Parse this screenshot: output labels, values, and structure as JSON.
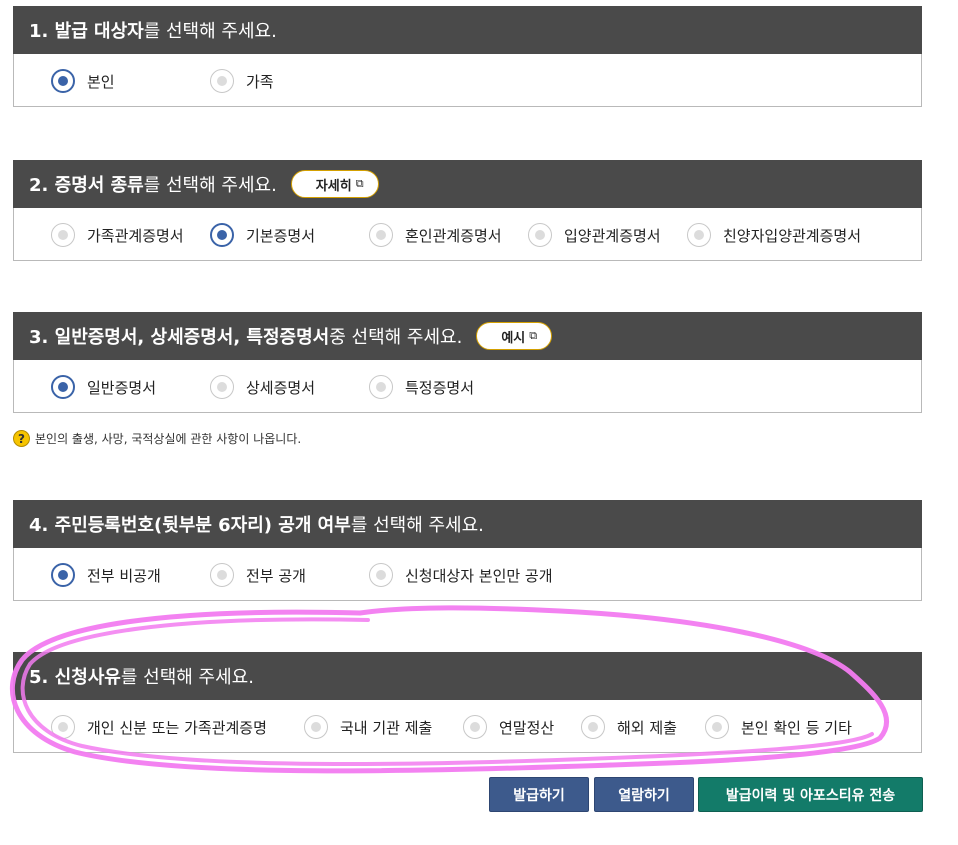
{
  "sections": [
    {
      "bold": "1. 발급 대상자",
      "rest": "를 선택해 주세요.",
      "suffix_bold": "",
      "suffix_rest": "",
      "options": [
        {
          "label": "본인",
          "selected": true
        },
        {
          "label": "가족",
          "selected": false
        }
      ]
    },
    {
      "bold": "2. 증명서 종류",
      "rest": "를 선택해 주세요.",
      "button": "자세히",
      "options": [
        {
          "label": "가족관계증명서",
          "selected": false
        },
        {
          "label": "기본증명서",
          "selected": true
        },
        {
          "label": "혼인관계증명서",
          "selected": false
        },
        {
          "label": "입양관계증명서",
          "selected": false
        },
        {
          "label": "친양자입양관계증명서",
          "selected": false
        }
      ]
    },
    {
      "bold": "3. 일반증명서, 상세증명서, 특정증명서",
      "rest": " 중 선택해 주세요.",
      "button": "예시",
      "options": [
        {
          "label": "일반증명서",
          "selected": true
        },
        {
          "label": "상세증명서",
          "selected": false
        },
        {
          "label": "특정증명서",
          "selected": false
        }
      ]
    },
    {
      "bold": "4. 주민등록번호(뒷부분 6자리) 공개 여부",
      "rest": "를 선택해 주세요.",
      "options": [
        {
          "label": "전부 비공개",
          "selected": true
        },
        {
          "label": "전부 공개",
          "selected": false
        },
        {
          "label": "신청대상자 본인만 공개",
          "selected": false
        }
      ]
    },
    {
      "bold": "5. 신청사유",
      "rest": "를 선택해 주세요.",
      "options": [
        {
          "label": "개인 신분 또는 가족관계증명",
          "selected": false
        },
        {
          "label": "국내 기관 제출",
          "selected": false
        },
        {
          "label": "연말정산",
          "selected": false
        },
        {
          "label": "해외 제출",
          "selected": false
        },
        {
          "label": "본인 확인 등 기타",
          "selected": false
        }
      ]
    }
  ],
  "help_text": "본인의 출생, 사망, 국적상실에 관한 사항이 나옵니다.",
  "help_icon": "?",
  "external_icon": "⧉",
  "buttons": {
    "issue": "발급하기",
    "view": "열람하기",
    "history": "발급이력 및 아포스티유 전송"
  },
  "colors": {
    "header_bg": "#4a4a4a",
    "radio_selected": "#3a63a8",
    "pill_border": "#d4a000",
    "btn_blue": "#3d5a8c",
    "btn_green": "#137b69",
    "annotation": "#f27bf0"
  }
}
